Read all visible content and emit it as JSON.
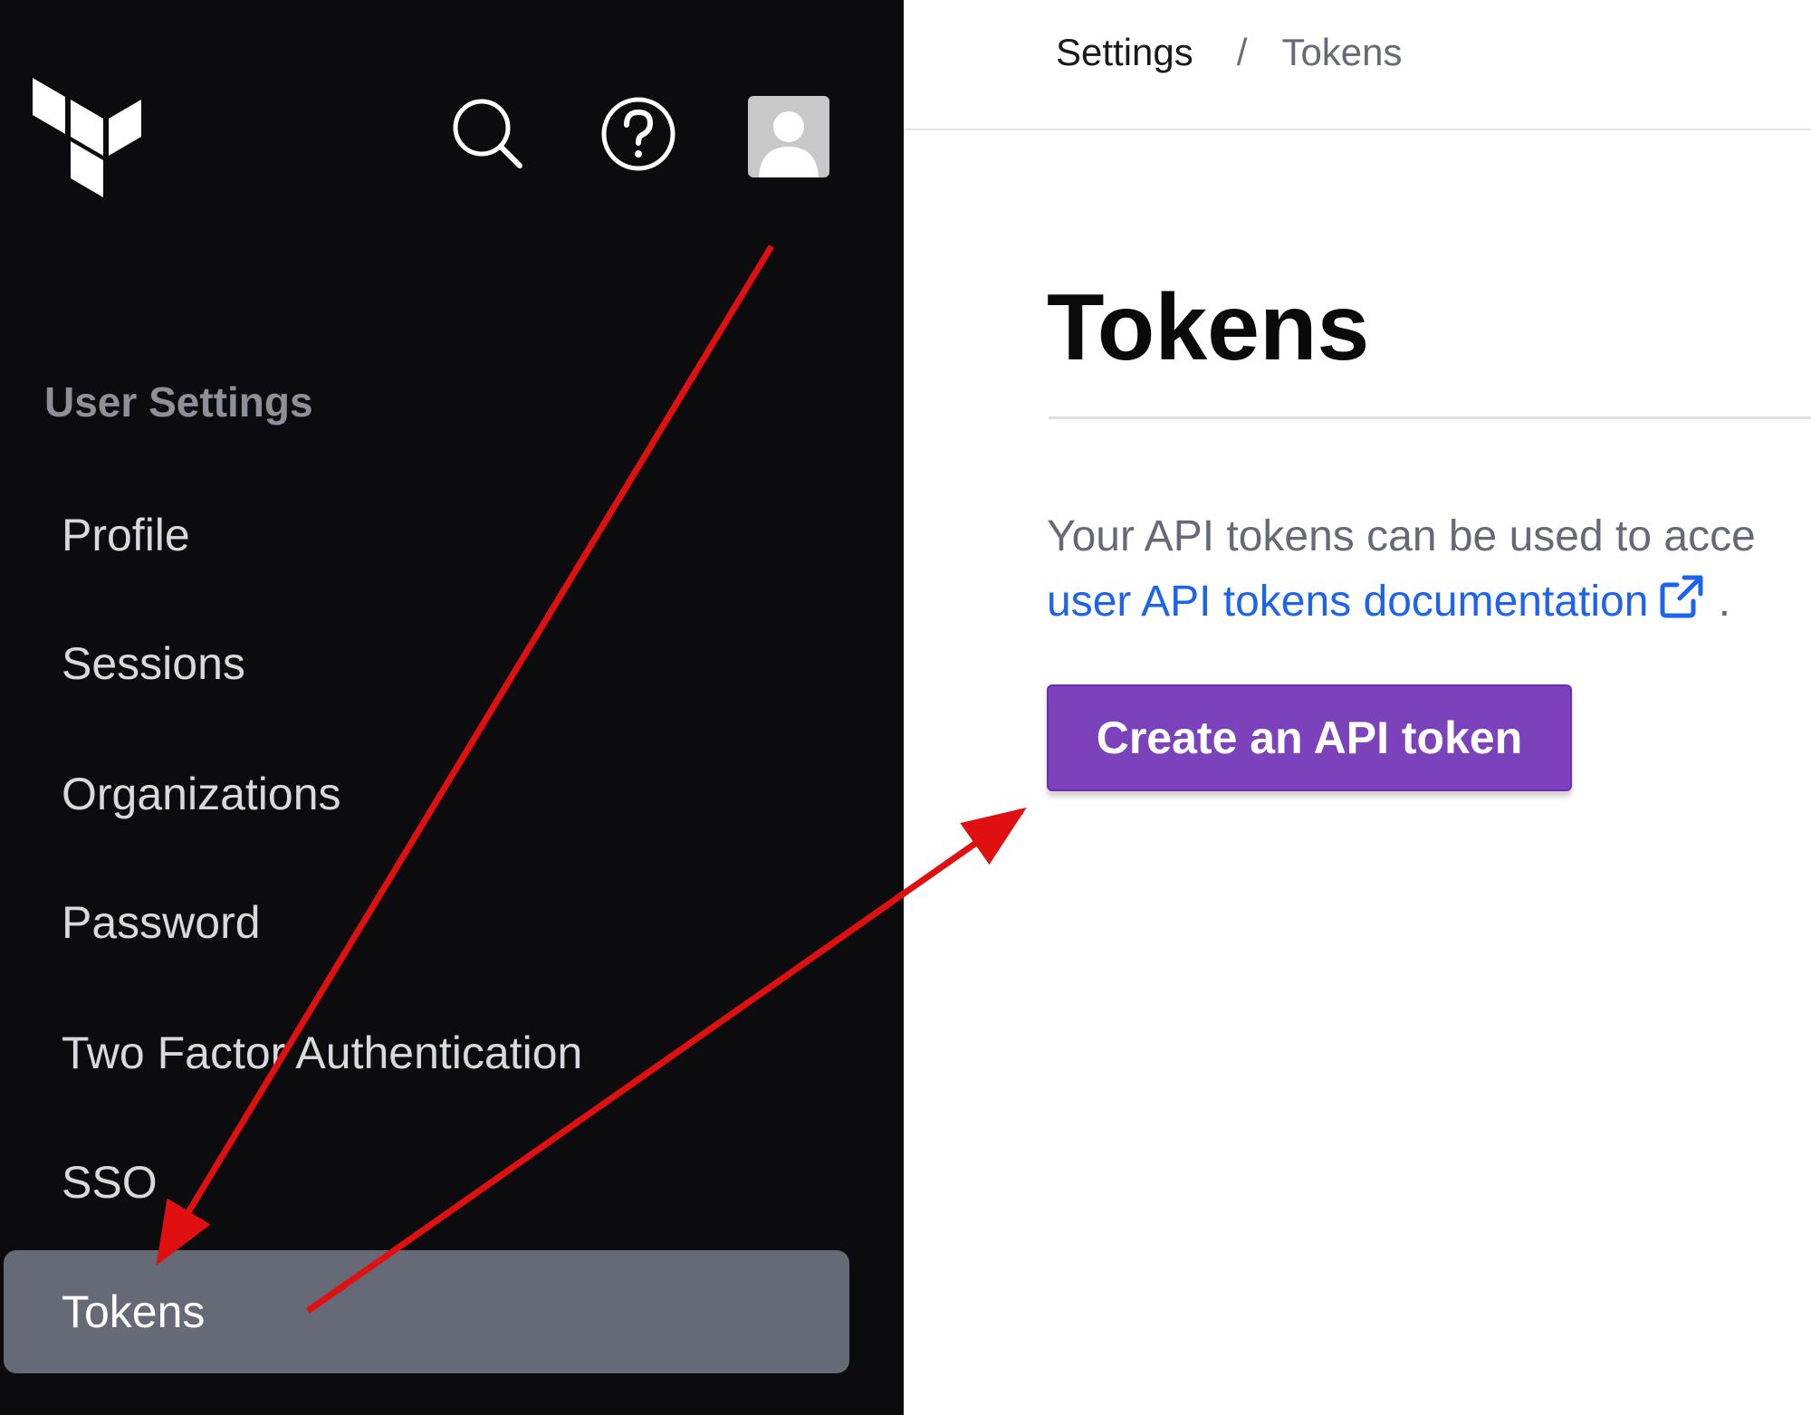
{
  "sidebar": {
    "section_label": "User Settings",
    "items": [
      {
        "label": "Profile"
      },
      {
        "label": "Sessions"
      },
      {
        "label": "Organizations"
      },
      {
        "label": "Password"
      },
      {
        "label": "Two Factor Authentication"
      },
      {
        "label": "SSO"
      },
      {
        "label": "Tokens",
        "active": true
      }
    ],
    "icons": {
      "logo": "terraform-logo",
      "search": "search-icon",
      "help": "help-icon",
      "avatar": "avatar"
    }
  },
  "breadcrumb": {
    "parent": "Settings",
    "separator": "/",
    "current": "Tokens"
  },
  "main": {
    "title": "Tokens",
    "description": "Your API tokens can be used to acce",
    "doc_link": "user API tokens documentation",
    "doc_link_suffix": ".",
    "create_button": "Create an API token"
  },
  "colors": {
    "sidebar_bg": "#0c0c0e",
    "active_item_bg": "#656a76",
    "button_bg": "#7b42bc",
    "link": "#1d63ed",
    "annotation_arrow": "#e01010"
  }
}
